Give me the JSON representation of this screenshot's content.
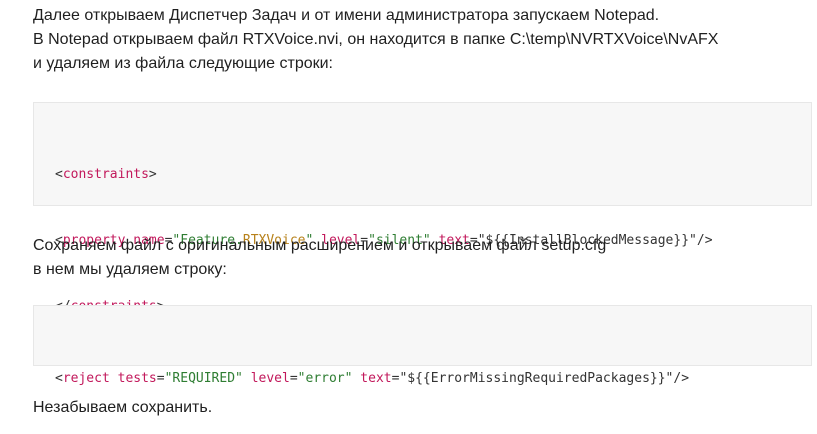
{
  "intro": {
    "lines": [
      "Далее открываем Диспетчер Задач и от имени администратора запускаем Notepad.",
      "В Notepad открываем файл RTXVoice.nvi, он находится в папке C:\\temp\\NVRTXVoice\\NvAFX",
      "и удаляем из файла следующие строки:"
    ]
  },
  "code1": {
    "line1": {
      "open": "<",
      "tag": "constraints",
      "close": ">"
    },
    "line2": {
      "open": "<",
      "tag": "property",
      "attr1_name": "name",
      "eq1": "=",
      "attr1_value_q1": "\"",
      "attr1_value_a": "Feature.",
      "attr1_value_b": "RTXVoice",
      "attr1_value_q2": "\"",
      "attr2_name": "level",
      "eq2": "=",
      "attr2_value": "\"silent\"",
      "attr3_name": "text",
      "eq3": "=",
      "attr3_value": "\"${{InstallBlockedMessage}}\"",
      "close": "/>"
    },
    "line3": {
      "open": "</",
      "tag": "constraints",
      "close": ">"
    }
  },
  "middle": {
    "lines": [
      "Сохраняем файл с оригинальным расширением и открываем файл setup.cfg",
      "в нем мы удаляем строку:"
    ]
  },
  "code2": {
    "line1": {
      "open": "<",
      "tag": "reject",
      "attr1_name": "tests",
      "eq1": "=",
      "attr1_value": "\"REQUIRED\"",
      "attr2_name": "level",
      "eq2": "=",
      "attr2_value": "\"error\"",
      "attr3_name": "text",
      "eq3": "=",
      "attr3_value": "\"${{ErrorMissingRequiredPackages}}\"",
      "close": "/>"
    }
  },
  "outro": {
    "text": "Незабываем сохранить."
  }
}
